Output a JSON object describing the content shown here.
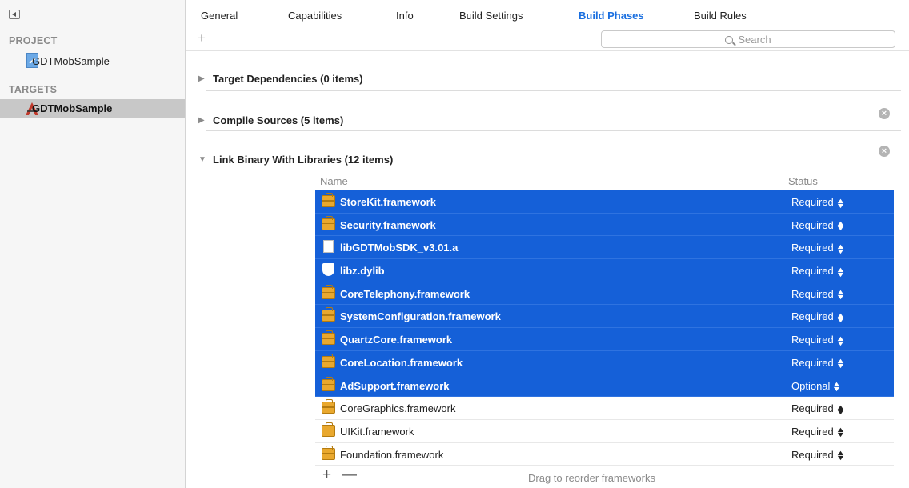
{
  "tabs": [
    {
      "label": "General",
      "active": false
    },
    {
      "label": "Capabilities",
      "active": false
    },
    {
      "label": "Info",
      "active": false
    },
    {
      "label": "Build Settings",
      "active": false
    },
    {
      "label": "Build Phases",
      "active": true
    },
    {
      "label": "Build Rules",
      "active": false
    }
  ],
  "sidebar": {
    "project_heading": "PROJECT",
    "project_item": "GDTMobSample",
    "targets_heading": "TARGETS",
    "target_item": "GDTMobSample"
  },
  "toolbar": {
    "add_label": "+",
    "search_placeholder": "Search"
  },
  "phases": [
    {
      "title": "Target Dependencies (0 items)",
      "expanded": false,
      "removable": false
    },
    {
      "title": "Compile Sources (5 items)",
      "expanded": false,
      "removable": true
    },
    {
      "title": "Link Binary With Libraries (12 items)",
      "expanded": true,
      "removable": true
    }
  ],
  "libraries": {
    "columns": {
      "name": "Name",
      "status": "Status"
    },
    "rows": [
      {
        "name": "StoreKit.framework",
        "status": "Required",
        "icon": "framework-icon",
        "selected": true
      },
      {
        "name": "Security.framework",
        "status": "Required",
        "icon": "framework-icon",
        "selected": true
      },
      {
        "name": "libGDTMobSDK_v3.01.a",
        "status": "Required",
        "icon": "static-library-icon",
        "selected": true
      },
      {
        "name": "libz.dylib",
        "status": "Required",
        "icon": "dylib-shield-icon",
        "selected": true
      },
      {
        "name": "CoreTelephony.framework",
        "status": "Required",
        "icon": "framework-icon",
        "selected": true
      },
      {
        "name": "SystemConfiguration.framework",
        "status": "Required",
        "icon": "framework-icon",
        "selected": true
      },
      {
        "name": "QuartzCore.framework",
        "status": "Required",
        "icon": "framework-icon",
        "selected": true
      },
      {
        "name": "CoreLocation.framework",
        "status": "Required",
        "icon": "framework-icon",
        "selected": true
      },
      {
        "name": "AdSupport.framework",
        "status": "Optional",
        "icon": "framework-icon",
        "selected": true
      },
      {
        "name": "CoreGraphics.framework",
        "status": "Required",
        "icon": "framework-icon",
        "selected": false
      },
      {
        "name": "UIKit.framework",
        "status": "Required",
        "icon": "framework-icon",
        "selected": false
      },
      {
        "name": "Foundation.framework",
        "status": "Required",
        "icon": "framework-icon",
        "selected": false
      }
    ],
    "footer": {
      "add": "+",
      "remove": "—",
      "hint": "Drag to reorder frameworks"
    }
  },
  "colors": {
    "accent": "#1a6fe0",
    "selection": "#1560d8",
    "framework": "#e9a82e"
  }
}
